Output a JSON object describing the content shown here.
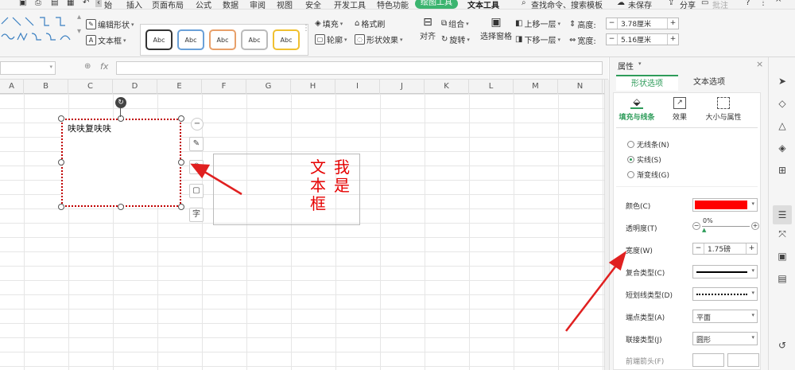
{
  "menubar": {
    "items": [
      "插入",
      "页面布局",
      "公式",
      "数据",
      "审阅",
      "视图",
      "安全",
      "开发工具",
      "特色功能",
      "绘图工具",
      "文本工具"
    ],
    "partial_left": "始",
    "search": "查找命令、搜索模板",
    "unsaved": "未保存",
    "share": "分享",
    "comment": "批注",
    "help": "?"
  },
  "ribbon": {
    "edit_shape": "编辑形状",
    "textbox": "文本框",
    "style_label": "Abc",
    "fill": "填充",
    "format_painter": "格式刷",
    "outline": "轮廓",
    "shape_effects": "形状效果",
    "align": "对齐",
    "group": "组合",
    "rotate": "旋转",
    "selection_pane": "选择窗格",
    "bring_forward": "上移一层",
    "send_backward": "下移一层",
    "height_label": "高度:",
    "height_value": "3.78厘米",
    "width_label": "宽度:",
    "width_value": "5.16厘米",
    "minus": "−",
    "plus": "+"
  },
  "formula": {
    "fx": "fx",
    "zoom_icon": "⊕"
  },
  "columns": [
    "A",
    "B",
    "C",
    "D",
    "E",
    "F",
    "G",
    "H",
    "I",
    "J",
    "K",
    "L",
    "M",
    "N"
  ],
  "sheet": {
    "textbox_text": "呋呋复呋呋",
    "vertical_col1": "文本框",
    "vertical_col2": "我是"
  },
  "float_tools": [
    "−",
    "✎",
    "⬡",
    "▢",
    "字"
  ],
  "panel": {
    "title": "属性",
    "tab_shape": "形状选项",
    "tab_text": "文本选项",
    "sub_fill": "填充与线条",
    "sub_effect": "效果",
    "sub_size": "大小与属性",
    "radio_none": "无线条(N)",
    "radio_solid": "实线(S)",
    "radio_gradient": "渐变线(G)",
    "color_label": "颜色(C)",
    "transparency_label": "透明度(T)",
    "transparency_value": "0%",
    "width_label": "宽度(W)",
    "width_value": "1.75磅",
    "compound_label": "复合类型(C)",
    "dash_label": "短划线类型(D)",
    "cap_label": "端点类型(A)",
    "cap_value": "平面",
    "join_label": "联接类型(J)",
    "join_value": "圆形",
    "arrow_label": "前端箭头(F)",
    "line_color": "#ff0000"
  },
  "sidebar_icons": [
    "cursor-icon",
    "shapes-icon",
    "fill-icon",
    "gem-icon",
    "grid-icon",
    "settings-sliders-icon",
    "transform-icon",
    "image-icon",
    "book-icon",
    "history-icon"
  ]
}
